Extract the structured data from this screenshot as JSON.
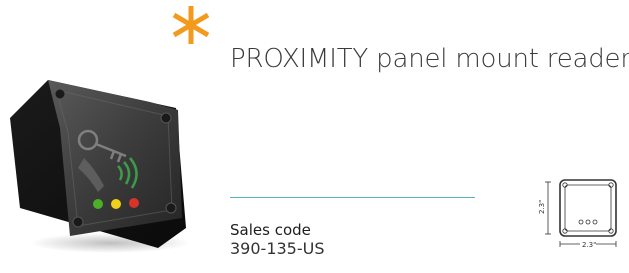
{
  "product": {
    "title": "PROXIMITY panel mount reader",
    "sales_label": "Sales code",
    "sales_code": "390-135-US"
  },
  "diagram": {
    "height_label": "2.3\"",
    "width_label": "2.3\""
  },
  "colors": {
    "accent_asterisk": "#f39a1e",
    "divider": "#56b4bd"
  },
  "icons": {
    "brand_mark": "orange-asterisk-icon",
    "key": "key-icon",
    "rfid_waves": "rfid-waves-icon"
  },
  "leds": [
    "green",
    "yellow",
    "red"
  ]
}
